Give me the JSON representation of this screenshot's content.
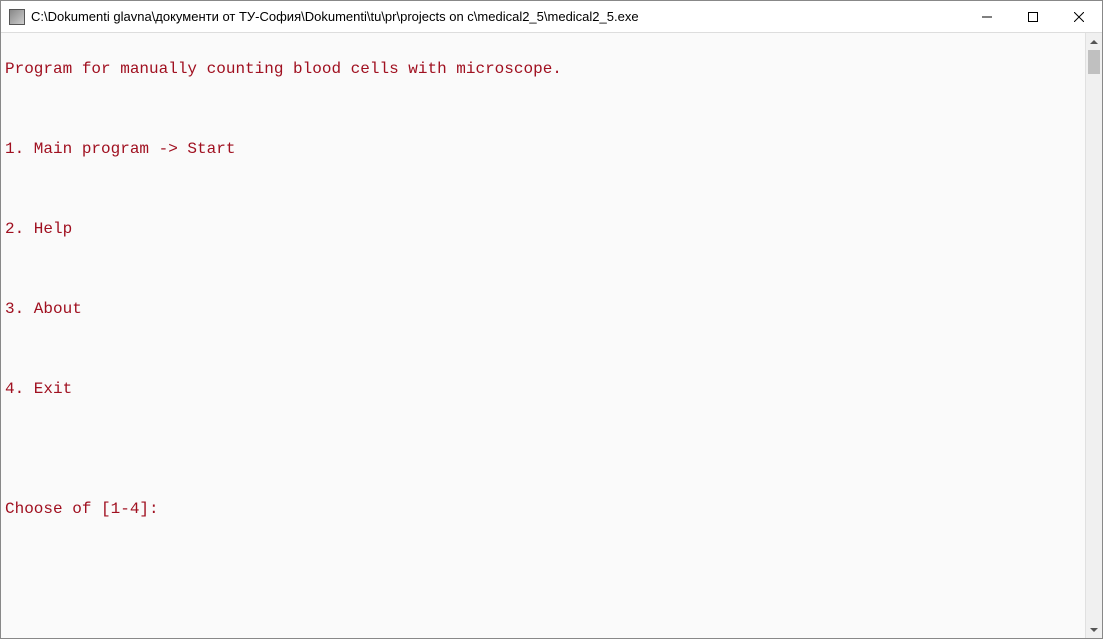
{
  "titlebar": {
    "title": "C:\\Dokumenti glavna\\документи от ТУ-София\\Dokumenti\\tu\\pr\\projects on c\\medical2_5\\medical2_5.exe"
  },
  "console": {
    "header": "Program for manually counting blood cells with microscope.",
    "menu_items": [
      "1. Main program -> Start",
      "2. Help",
      "3. About",
      "4. Exit"
    ],
    "prompt": "Choose of [1-4]:"
  }
}
